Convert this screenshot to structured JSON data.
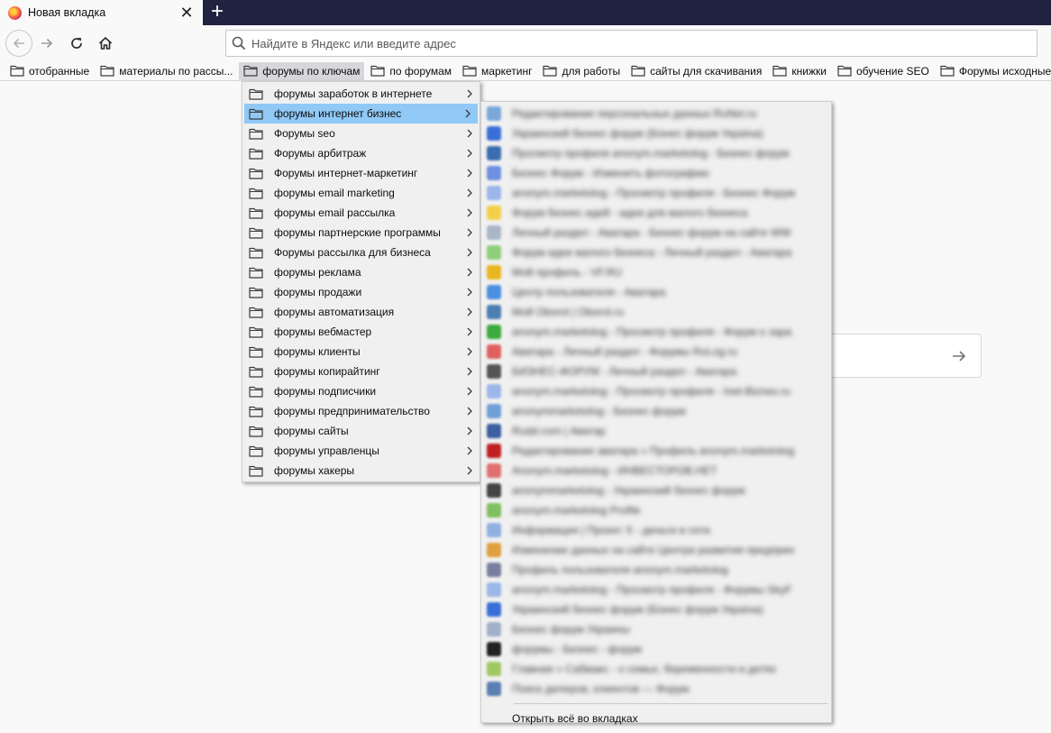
{
  "tab": {
    "title": "Новая вкладка",
    "close_glyph": "✕",
    "favicon": "firefox-icon"
  },
  "new_tab_glyph": "+",
  "urlbar": {
    "placeholder": "Найдите в Яндекс или введите адрес"
  },
  "bookmarks_toolbar": [
    "отобранные",
    "материалы по рассы...",
    "форумы по ключам",
    "по форумам",
    "маркетинг",
    "для работы",
    "сайты для скачивания",
    "книжки",
    "обучение SEO",
    "Форумы исходные"
  ],
  "open_bookmark_index": 2,
  "folder_menu": {
    "items": [
      "форумы заработок в интернете",
      "форумы интернет бизнес",
      "Форумы seo",
      "Форумы арбитраж",
      "Форумы интернет-маркетинг",
      "форумы email marketing",
      "форумы email рассылка",
      "форумы партнерские программы",
      "Форумы рассылка для бизнеса",
      "форумы реклама",
      "форумы продажи",
      "форумы автоматизация",
      "форумы вебмастер",
      "форумы клиенты",
      "форумы копирайтинг",
      "форумы подписчики",
      "форумы предпринимательство",
      "форумы сайты",
      "форумы управленцы",
      "форумы хакеры"
    ],
    "highlighted_index": 1
  },
  "submenu": {
    "items": [
      {
        "text": "Редактирование персональных данных RuNet.ru",
        "color": "#7aa7d8"
      },
      {
        "text": "Украинский бизнес форум (Бізнес форум Україна)",
        "color": "#3a6fd8"
      },
      {
        "text": "Просмотр профиля anonym.marketolog - Бизнес форум",
        "color": "#3b6db0"
      },
      {
        "text": "Бизнес Форум - Изменить фотографию",
        "color": "#6f8fe0"
      },
      {
        "text": "anonym.marketolog - Просмотр профиля - Бизнес Форум",
        "color": "#9bb6e8"
      },
      {
        "text": "Форум бизнес идей - идеи для малого бизнеса",
        "color": "#f3d04a"
      },
      {
        "text": "Личный раздел - Аватара - Бизнес форум на сайте WW",
        "color": "#a9b6c7"
      },
      {
        "text": "Форум идеи малого бизнеса - Личный раздел - Аватара",
        "color": "#8fcf7a"
      },
      {
        "text": "Мой профиль - VF.RU",
        "color": "#e8b620"
      },
      {
        "text": "Центр пользователя - Аватара",
        "color": "#4a8fe0"
      },
      {
        "text": "Мой Oborot | Oborot.ru",
        "color": "#4a7fb0"
      },
      {
        "text": "anonym.marketolog - Просмотр профиля - Форум о зара",
        "color": "#3caa3c"
      },
      {
        "text": "Аватара - Личный раздел - Форумы RoLog.ru",
        "color": "#e06060"
      },
      {
        "text": "БИЗНЕС-ФОРУМ - Личный раздел - Аватара",
        "color": "#555555"
      },
      {
        "text": "anonym.marketolog - Просмотр профиля - Inet-Biznes.ru",
        "color": "#9bb6e8"
      },
      {
        "text": "anonymmarketolog - Бизнес форум",
        "color": "#6fa0d8"
      },
      {
        "text": "Rudd.com | Аватар",
        "color": "#3b5fa0"
      },
      {
        "text": "Редактирование аватара » Профиль anonym.marketolog",
        "color": "#c02020"
      },
      {
        "text": "Anonym.marketolog - ИНВЕСТОРОВ.НЕТ",
        "color": "#e07070"
      },
      {
        "text": "anonymmarketolog - Украинский бизнес форум",
        "color": "#444444"
      },
      {
        "text": "anonym.marketolog Profile",
        "color": "#7fbf5f"
      },
      {
        "text": "Информация | Проект X - деньги в сети",
        "color": "#8fb0e0"
      },
      {
        "text": "Изменение данных на сайте Центра развития предприн",
        "color": "#e0a040"
      },
      {
        "text": "Профиль пользователя anonym.marketolog",
        "color": "#7a7fa0"
      },
      {
        "text": "anonym.marketolog - Просмотр профиля - Форумы SkyF",
        "color": "#9bb6e8"
      },
      {
        "text": "Украинский бизнес форум (Бізнес форум Україна)",
        "color": "#3a6fd8"
      },
      {
        "text": "Бизнес форум Украины",
        "color": "#a0b0c8"
      },
      {
        "text": "форумы - Бизнес - форум",
        "color": "#222222"
      },
      {
        "text": "Главная » Сабмакс - о семье, беременности и детях",
        "color": "#a0c860"
      },
      {
        "text": "Поиск дилеров, клиентов — Форум",
        "color": "#5a7fb0"
      }
    ],
    "open_all_label": "Открыть всё во вкладках"
  }
}
